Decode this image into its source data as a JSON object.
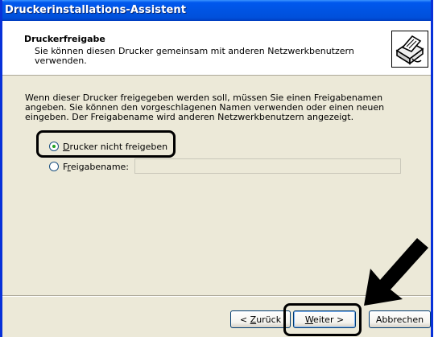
{
  "window": {
    "title": "Druckerinstallations-Assistent"
  },
  "header": {
    "title": "Druckerfreigabe",
    "subtitle": "Sie können diesen Drucker gemeinsam mit anderen Netzwerkbenutzern verwenden.",
    "icon": "printer-share-icon"
  },
  "body": {
    "description": "Wenn dieser Drucker freigegeben werden soll, müssen Sie einen Freigabenamen angeben. Sie können den vorgeschlagenen Namen verwenden oder einen neuen eingeben. Der Freigabename wird anderen Netzwerkbenutzern angezeigt.",
    "options": [
      {
        "label": "Drucker nicht freigeben",
        "accesskey": "D",
        "selected": true
      },
      {
        "label": "Freigabename:",
        "accesskey": "r",
        "selected": false
      }
    ],
    "share_name_value": ""
  },
  "buttons": {
    "back": "< Zurück",
    "next": "Weiter >",
    "cancel": "Abbrechen"
  },
  "annotations": {
    "arrow_icon": "pointer-arrow-icon",
    "highlight_color": "#000000"
  }
}
